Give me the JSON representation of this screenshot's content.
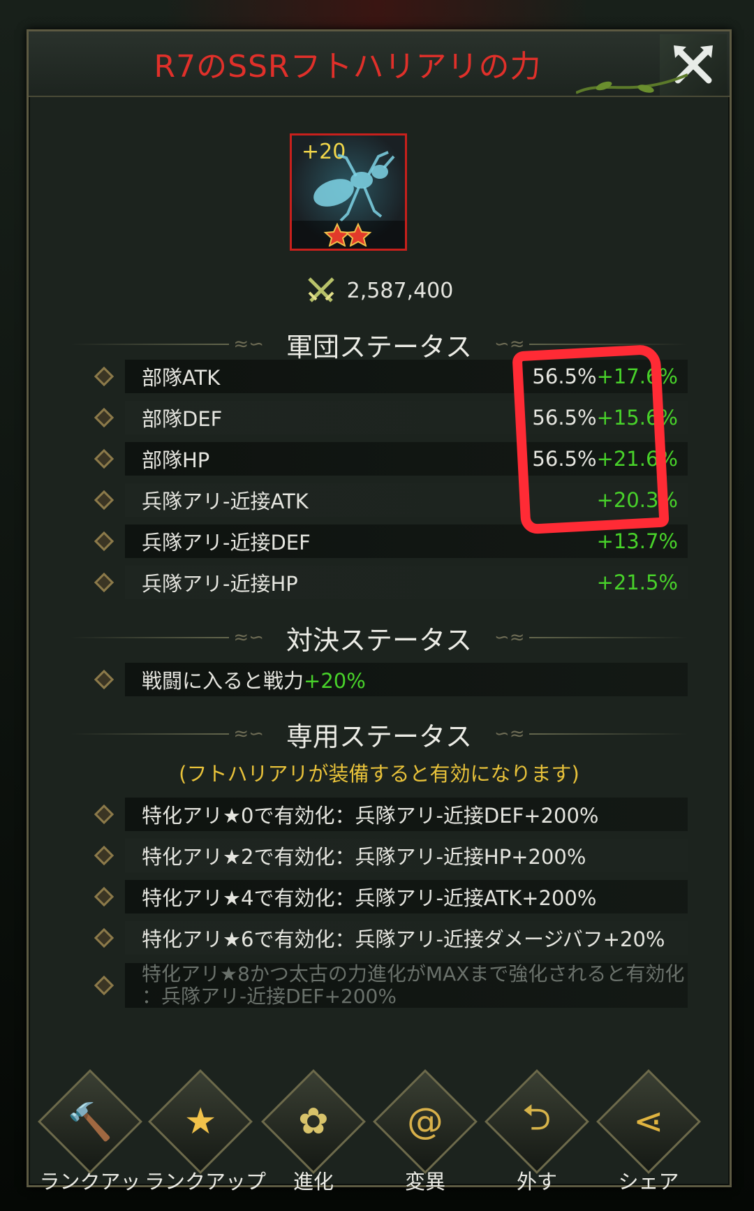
{
  "dialog": {
    "title": "R7のSSRフトハリアリの力",
    "close_icon": "close-x-icon"
  },
  "item": {
    "level_badge": "+20",
    "star_count": 2,
    "icon": "ant-silhouette-icon"
  },
  "power": {
    "icon": "crossed-swords-icon",
    "value": "2,587,400"
  },
  "sections": {
    "legion": {
      "title": "軍団ステータス",
      "rows": [
        {
          "label": "部隊ATK",
          "base": "56.5%",
          "bonus": "+17.6%"
        },
        {
          "label": "部隊DEF",
          "base": "56.5%",
          "bonus": "+15.6%"
        },
        {
          "label": "部隊HP",
          "base": "56.5%",
          "bonus": "+21.6%"
        },
        {
          "label": "兵隊アリ-近接ATK",
          "base": "",
          "bonus": "+20.3%"
        },
        {
          "label": "兵隊アリ-近接DEF",
          "base": "",
          "bonus": "+13.7%"
        },
        {
          "label": "兵隊アリ-近接HP",
          "base": "",
          "bonus": "+21.5%"
        }
      ]
    },
    "duel": {
      "title": "対決ステータス",
      "row": {
        "label": "戦闘に入ると戦力",
        "bonus": "+20%"
      }
    },
    "exclusive": {
      "title": "専用ステータス",
      "note": "(フトハリアリが装備すると有効になります)",
      "rows": [
        "特化アリ★0で有効化：兵隊アリ-近接DEF+200%",
        "特化アリ★2で有効化：兵隊アリ-近接HP+200%",
        "特化アリ★4で有効化：兵隊アリ-近接ATK+200%",
        "特化アリ★6で有効化：兵隊アリ-近接ダメージバフ+20%"
      ],
      "locked_row": {
        "line1": "特化アリ★8かつ太古の力進化がMAXまで強化されると有効化",
        "line2": "：兵隊アリ-近接DEF+200%"
      }
    }
  },
  "actions": [
    {
      "label": "ランクアッ",
      "icon": "hammer-upgrade-icon"
    },
    {
      "label": "ランクアップ",
      "icon": "star-upgrade-icon"
    },
    {
      "label": "進化",
      "icon": "flower-evolve-icon"
    },
    {
      "label": "変異",
      "icon": "spiral-mutate-icon"
    },
    {
      "label": "外す",
      "icon": "unequip-icon"
    },
    {
      "label": "シェア",
      "icon": "share-icon"
    }
  ],
  "colors": {
    "title": "#e0302a",
    "bonus_green": "#48d22a",
    "note_gold": "#e8c23a",
    "highlight_red": "#ff2b35"
  }
}
